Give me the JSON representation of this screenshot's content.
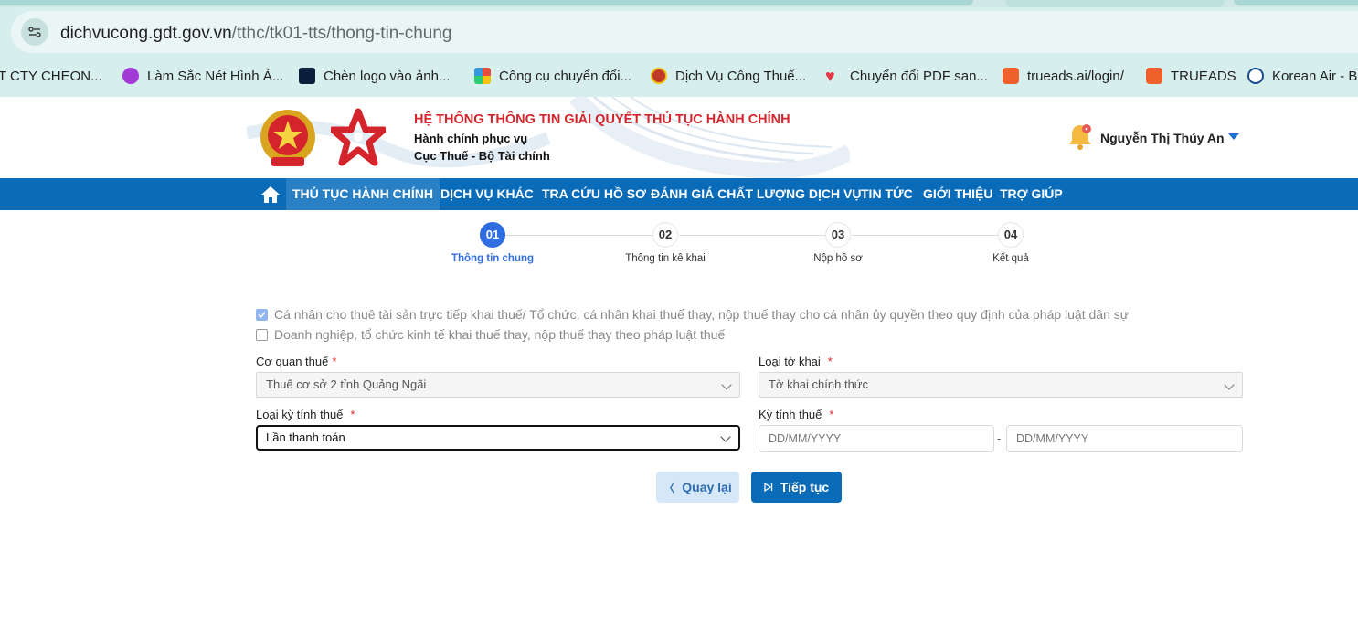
{
  "browser": {
    "url_host": "dichvucong.gdt.gov.vn",
    "url_path": "/tthc/tk01-tts/thong-tin-chung",
    "bookmarks": [
      {
        "label": "T CTY CHEON...",
        "icon": "none"
      },
      {
        "label": "Làm Sắc Nét Hình Ả...",
        "icon": "picsart-icon",
        "color": "#a23ad6"
      },
      {
        "label": "Chèn logo vào ảnh...",
        "icon": "photoshop-icon",
        "color": "#0b1e3a"
      },
      {
        "label": "Công cụ chuyển đổi...",
        "icon": "tiles-icon",
        "color": "#e74c3c"
      },
      {
        "label": "Dịch Vụ Công Thuế...",
        "icon": "emblem-icon",
        "color": "#c0392b"
      },
      {
        "label": "Chuyển đổi PDF san...",
        "icon": "heart-icon",
        "color": "#e53946"
      },
      {
        "label": "trueads.ai/login/",
        "icon": "trueads-icon",
        "color": "#f0602c"
      },
      {
        "label": "TRUEADS",
        "icon": "trueads-icon",
        "color": "#f0602c"
      },
      {
        "label": "Korean Air - Bo",
        "icon": "koreanair-icon",
        "color": "#1a4d8f"
      }
    ]
  },
  "header": {
    "title": "HỆ THỐNG THÔNG TIN GIẢI QUYẾT THỦ TỤC HÀNH CHÍNH",
    "subtitle1": "Hành chính phục vụ",
    "subtitle2": "Cục Thuế - Bộ Tài chính",
    "user_name": "Nguyễn Thị Thúy An"
  },
  "nav": {
    "items": [
      {
        "label": "THỦ TỤC HÀNH CHÍNH",
        "active": true
      },
      {
        "label": "DỊCH VỤ KHÁC",
        "active": false
      },
      {
        "label": "TRA CỨU HỒ SƠ",
        "active": false
      },
      {
        "label": "ĐÁNH GIÁ CHẤT LƯỢNG DỊCH VỤ",
        "active": false
      },
      {
        "label": "TIN TỨC",
        "active": false
      },
      {
        "label": "GIỚI THIỆU",
        "active": false
      },
      {
        "label": "TRỢ GIÚP",
        "active": false
      }
    ]
  },
  "stepper": {
    "steps": [
      {
        "number": "01",
        "label": "Thông tin chung",
        "active": true
      },
      {
        "number": "02",
        "label": "Thông tin kê khai",
        "active": false
      },
      {
        "number": "03",
        "label": "Nộp hồ sơ",
        "active": false
      },
      {
        "number": "04",
        "label": "Kết quả",
        "active": false
      }
    ]
  },
  "form": {
    "option1": {
      "label": "Cá nhân cho thuê tài sản trực tiếp khai thuế/ Tổ chức, cá nhân khai thuế thay, nộp thuế thay cho cá nhân ủy quyền theo quy định của pháp luật dân sự",
      "checked": true
    },
    "option2": {
      "label": "Doanh nghiệp, tổ chức kinh tế khai thuế thay, nộp thuế thay theo pháp luật thuế",
      "checked": false
    },
    "tax_office": {
      "label": "Cơ quan thuế",
      "required": "*",
      "value": "Thuế cơ sở 2 tỉnh Quảng Ngãi"
    },
    "declaration_type": {
      "label": "Loại tờ khai",
      "required": "*",
      "value": "Tờ khai chính thức"
    },
    "period_type": {
      "label": "Loại kỳ tính thuế",
      "required": "*",
      "value": "Lần thanh toán"
    },
    "period": {
      "label": "Kỳ tính thuế",
      "required": "*",
      "from_placeholder": "DD/MM/YYYY",
      "separator": "-",
      "to_placeholder": "DD/MM/YYYY"
    }
  },
  "actions": {
    "back_label": "Quay lại",
    "next_label": "Tiếp tục"
  },
  "colors": {
    "primary": "#0a6cb8",
    "accent_red": "#d4242c",
    "step_active": "#2f6de0"
  }
}
